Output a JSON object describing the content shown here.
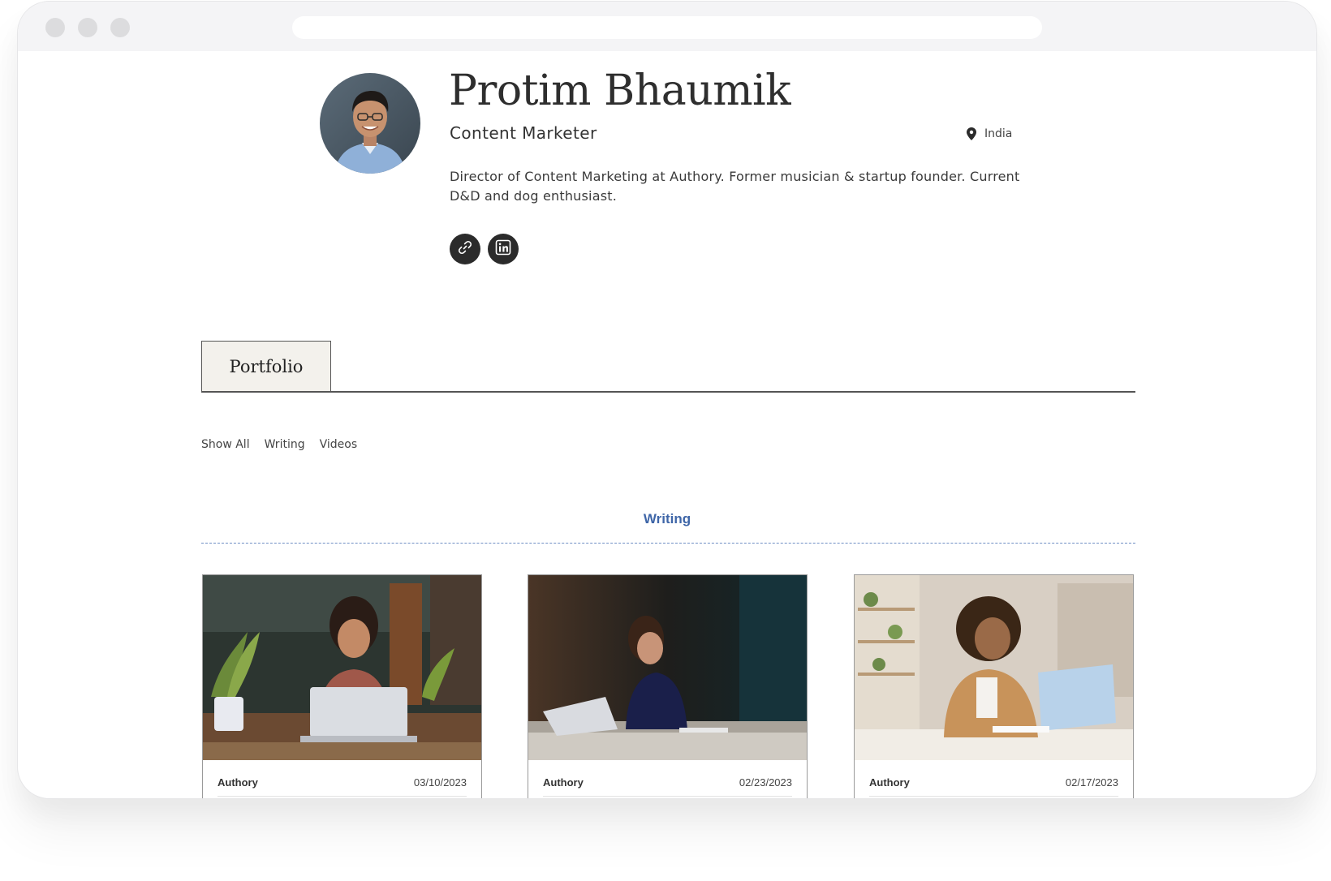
{
  "profile": {
    "name": "Protim Bhaumik",
    "role": "Content Marketer",
    "location": "India",
    "bio": "Director of Content Marketing at Authory. Former musician & startup founder. Current D&D and dog enthusiast.",
    "socials": [
      {
        "icon": "link-icon"
      },
      {
        "icon": "linkedin-icon"
      }
    ]
  },
  "tabs": [
    {
      "label": "Portfolio",
      "active": true
    }
  ],
  "filters": [
    "Show All",
    "Writing",
    "Videos"
  ],
  "section": {
    "title": "Writing",
    "accent_color": "#3f66a8"
  },
  "cards": [
    {
      "source": "Authory",
      "date": "03/10/2023"
    },
    {
      "source": "Authory",
      "date": "02/23/2023"
    },
    {
      "source": "Authory",
      "date": "02/17/2023"
    }
  ]
}
